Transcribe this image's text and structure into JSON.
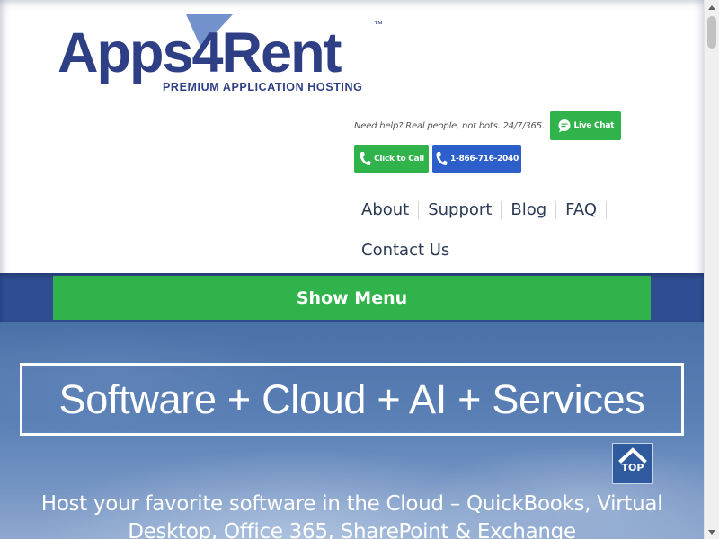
{
  "header": {
    "logo_text": "Apps4Rent",
    "logo_trademark": "™",
    "logo_tagline": "PREMIUM APPLICATION HOSTING"
  },
  "contact": {
    "help_text": "Need help? Real people, not bots. 24/7/365.",
    "live_chat_label": "Live Chat",
    "click_to_call_label": "Click to Call",
    "phone_label": "1-866-716-2040"
  },
  "nav": {
    "items": [
      "About",
      "Support",
      "Blog",
      "FAQ",
      "Contact Us"
    ]
  },
  "menu": {
    "show_menu_label": "Show Menu"
  },
  "hero": {
    "title": "Software + Cloud + AI + Services",
    "subtitle": "Host your favorite software in the Cloud – QuickBooks, Virtual Desktop, Office 365, SharePoint & Exchange",
    "top_button_label": "TOP"
  },
  "colors": {
    "brand_navy": "#2e3f86",
    "green": "#2fb34a",
    "blue": "#2c5fc9",
    "menu_band": "#2f4d93"
  }
}
